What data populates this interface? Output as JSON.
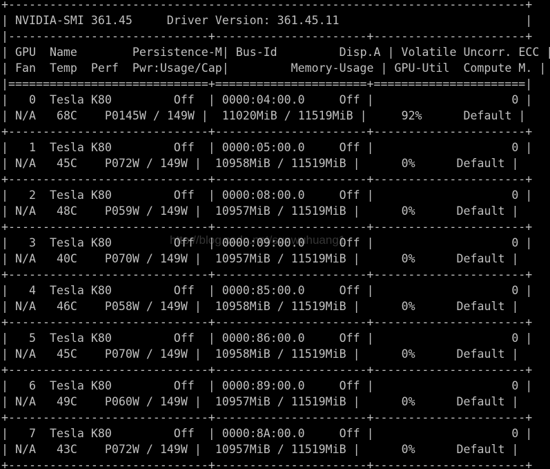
{
  "header": {
    "smi_version": "361.45",
    "driver_version": "361.45.11"
  },
  "column_headers": {
    "line1": [
      "GPU",
      "Name",
      "Persistence-M",
      "Bus-Id",
      "Disp.A",
      "Volatile Uncorr. ECC"
    ],
    "line2": [
      "Fan",
      "Temp",
      "Perf",
      "Pwr:Usage/Cap",
      "Memory-Usage",
      "GPU-Util",
      "Compute M."
    ]
  },
  "gpus": [
    {
      "id": "0",
      "name": "Tesla K80",
      "persistence": "Off",
      "bus_id": "0000:04:00.0",
      "disp": "Off",
      "ecc": "0",
      "fan": "N/A",
      "temp": "68C",
      "perf": "P0",
      "pwr_usage": "145W",
      "pwr_cap": "149W",
      "mem_used": "11020MiB",
      "mem_total": "11519MiB",
      "util": "92%",
      "compute": "Default"
    },
    {
      "id": "1",
      "name": "Tesla K80",
      "persistence": "Off",
      "bus_id": "0000:05:00.0",
      "disp": "Off",
      "ecc": "0",
      "fan": "N/A",
      "temp": "45C",
      "perf": "P0",
      "pwr_usage": "72W",
      "pwr_cap": "149W",
      "mem_used": "10958MiB",
      "mem_total": "11519MiB",
      "util": "0%",
      "compute": "Default"
    },
    {
      "id": "2",
      "name": "Tesla K80",
      "persistence": "Off",
      "bus_id": "0000:08:00.0",
      "disp": "Off",
      "ecc": "0",
      "fan": "N/A",
      "temp": "48C",
      "perf": "P0",
      "pwr_usage": "59W",
      "pwr_cap": "149W",
      "mem_used": "10957MiB",
      "mem_total": "11519MiB",
      "util": "0%",
      "compute": "Default"
    },
    {
      "id": "3",
      "name": "Tesla K80",
      "persistence": "Off",
      "bus_id": "0000:09:00.0",
      "disp": "Off",
      "ecc": "0",
      "fan": "N/A",
      "temp": "40C",
      "perf": "P0",
      "pwr_usage": "70W",
      "pwr_cap": "149W",
      "mem_used": "10957MiB",
      "mem_total": "11519MiB",
      "util": "0%",
      "compute": "Default"
    },
    {
      "id": "4",
      "name": "Tesla K80",
      "persistence": "Off",
      "bus_id": "0000:85:00.0",
      "disp": "Off",
      "ecc": "0",
      "fan": "N/A",
      "temp": "46C",
      "perf": "P0",
      "pwr_usage": "58W",
      "pwr_cap": "149W",
      "mem_used": "10958MiB",
      "mem_total": "11519MiB",
      "util": "0%",
      "compute": "Default"
    },
    {
      "id": "5",
      "name": "Tesla K80",
      "persistence": "Off",
      "bus_id": "0000:86:00.0",
      "disp": "Off",
      "ecc": "0",
      "fan": "N/A",
      "temp": "45C",
      "perf": "P0",
      "pwr_usage": "70W",
      "pwr_cap": "149W",
      "mem_used": "10958MiB",
      "mem_total": "11519MiB",
      "util": "0%",
      "compute": "Default"
    },
    {
      "id": "6",
      "name": "Tesla K80",
      "persistence": "Off",
      "bus_id": "0000:89:00.0",
      "disp": "Off",
      "ecc": "0",
      "fan": "N/A",
      "temp": "49C",
      "perf": "P0",
      "pwr_usage": "60W",
      "pwr_cap": "149W",
      "mem_used": "10957MiB",
      "mem_total": "11519MiB",
      "util": "0%",
      "compute": "Default"
    },
    {
      "id": "7",
      "name": "Tesla K80",
      "persistence": "Off",
      "bus_id": "0000:8A:00.0",
      "disp": "Off",
      "ecc": "0",
      "fan": "N/A",
      "temp": "43C",
      "perf": "P0",
      "pwr_usage": "72W",
      "pwr_cap": "149W",
      "mem_used": "10957MiB",
      "mem_total": "11519MiB",
      "util": "0%",
      "compute": "Default"
    }
  ],
  "watermark": "http://blog.csdn.net/sunwuhuang1",
  "colors": {
    "background": "#000000",
    "foreground": "#c0c0c0"
  }
}
